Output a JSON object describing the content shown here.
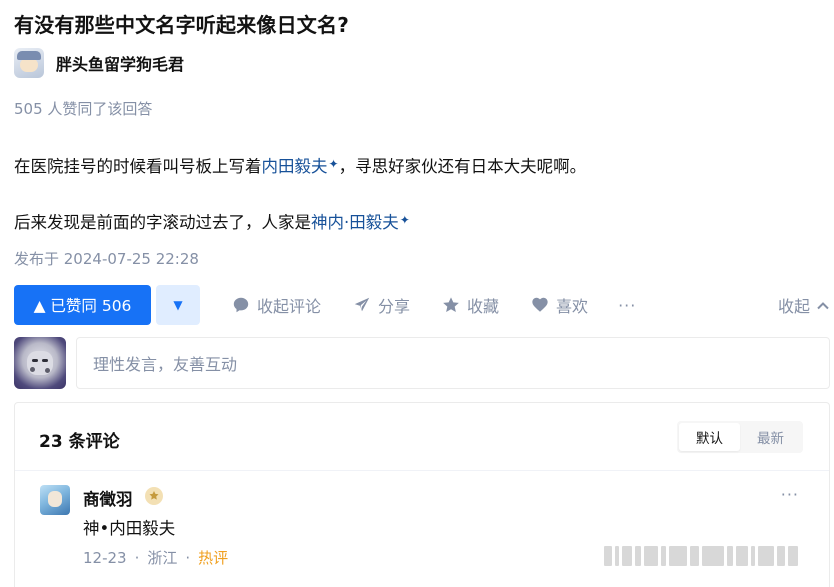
{
  "question": {
    "title": "有没有那些中文名字听起来像日文名?"
  },
  "author": {
    "name": "胖头鱼留学狗毛君"
  },
  "answer": {
    "upvote_note": "505 人赞同了该回答",
    "p1_before": "在医院挂号的时候看叫号板上写着",
    "p1_link": "内田毅夫",
    "p1_after": "，寻思好家伙还有日本大夫呢啊。",
    "p2_before": "后来发现是前面的字滚动过去了，人家是",
    "p2_link": "神内·田毅夫",
    "spark_glyph": "✦",
    "published": "发布于 2024-07-25 22:28"
  },
  "actions": {
    "upvote_label": "▲ 已赞同 506",
    "downvote_glyph": "▼",
    "collapse_comments": "收起评论",
    "share": "分享",
    "favorite": "收藏",
    "like": "喜欢",
    "more": "···",
    "collapse": "收起"
  },
  "comment_input": {
    "placeholder": "理性发言，友善互动"
  },
  "comments": {
    "count_label": "23 条评论",
    "sort_default": "默认",
    "sort_latest": "最新",
    "items": [
      {
        "user": "商徵羽",
        "text": "神•内田毅夫",
        "date": "12-23",
        "location": "浙江",
        "tag": "热评",
        "more": "···"
      }
    ]
  },
  "colors": {
    "accent": "#1772f6",
    "link": "#175199",
    "muted": "#8590a6",
    "hot": "#f0a020"
  },
  "icons": [
    "comment-icon",
    "share-icon",
    "star-icon",
    "heart-icon",
    "chevron-up-icon",
    "badge-icon"
  ]
}
